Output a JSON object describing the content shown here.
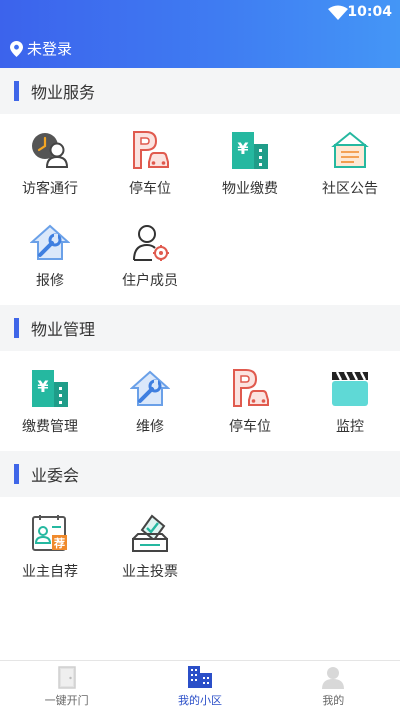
{
  "status_bar": {
    "time": "10:04"
  },
  "header": {
    "location_label": "未登录"
  },
  "sections": [
    {
      "title": "物业服务",
      "items": [
        {
          "label": "访客通行",
          "icon": "visitor-clock-icon"
        },
        {
          "label": "停车位",
          "icon": "parking-icon"
        },
        {
          "label": "物业缴费",
          "icon": "property-fee-icon"
        },
        {
          "label": "社区公告",
          "icon": "notice-board-icon"
        },
        {
          "label": "报修",
          "icon": "repair-house-icon"
        },
        {
          "label": "住户成员",
          "icon": "resident-member-icon"
        }
      ]
    },
    {
      "title": "物业管理",
      "items": [
        {
          "label": "缴费管理",
          "icon": "property-fee-icon"
        },
        {
          "label": "维修",
          "icon": "repair-house-icon"
        },
        {
          "label": "停车位",
          "icon": "parking-icon"
        },
        {
          "label": "监控",
          "icon": "clapperboard-icon"
        }
      ]
    },
    {
      "title": "业委会",
      "items": [
        {
          "label": "业主自荐",
          "icon": "self-recommend-icon",
          "badge": "荐"
        },
        {
          "label": "业主投票",
          "icon": "ballot-box-icon"
        }
      ]
    }
  ],
  "tabbar": [
    {
      "label": "一键开门",
      "icon": "door-icon",
      "active": false
    },
    {
      "label": "我的小区",
      "icon": "buildings-icon",
      "active": true
    },
    {
      "label": "我的",
      "icon": "user-icon",
      "active": false
    }
  ],
  "colors": {
    "accent": "#3f66e8",
    "teal": "#25b8a0",
    "red": "#e05a4e",
    "orange": "#f08a2c"
  }
}
